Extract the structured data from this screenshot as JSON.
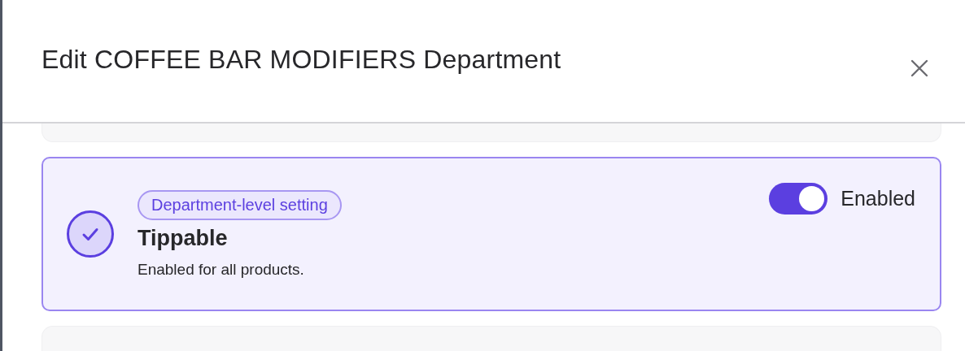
{
  "dialog": {
    "title": "Edit COFFEE BAR MODIFIERS Department"
  },
  "setting": {
    "badge": "Department-level setting",
    "title": "Tippable",
    "description": "Enabled for all products.",
    "checked": true,
    "toggle": {
      "on": true,
      "label": "Enabled"
    }
  }
}
